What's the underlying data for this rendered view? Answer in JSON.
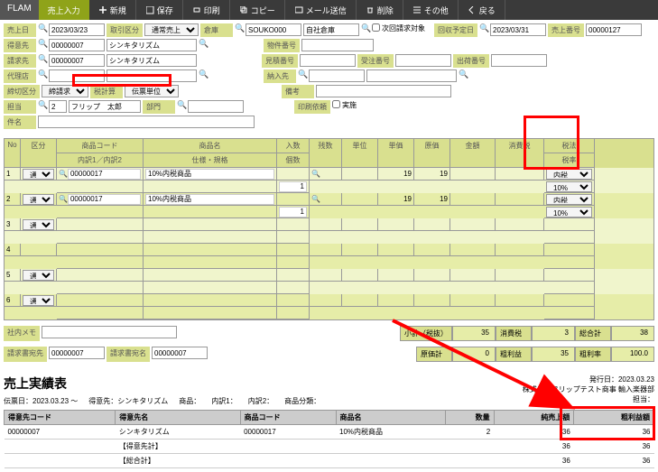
{
  "toolbar": {
    "logo": "FLAM",
    "active": "売上入力",
    "buttons": [
      "新規",
      "保存",
      "印刷",
      "コピー",
      "メール送信",
      "削除",
      "その他",
      "戻る"
    ]
  },
  "form": {
    "uriage_date_label": "売上日",
    "uriage_date": "2023/03/23",
    "torihiki_label": "取引区分",
    "torihiki": "通常売上",
    "souko_label": "倉庫",
    "souko": "SOUKO000",
    "souko_name": "自社倉庫",
    "jikai_label": "次回請求対象",
    "kaishu_label": "回収予定日",
    "kaishu_date": "2023/03/31",
    "uriage_no_label": "売上番号",
    "uriage_no": "00000127",
    "tokuisaki_label": "得意先",
    "tokuisaki_code": "00000007",
    "tokuisaki_name": "シンキタリズム",
    "bukken_label": "物件番号",
    "seikyu_label": "請求先",
    "seikyu_code": "00000007",
    "seikyu_name": "シンキタリズム",
    "mitsumori_label": "見積番号",
    "juchuno_label": "受注番号",
    "shukka_label": "出荷番号",
    "dairi_label": "代理店",
    "nounyu_label": "納入先",
    "shimekiri_label": "締切区分",
    "shimekiri_val": "締請求",
    "zeikei_label": "税計算",
    "denpyo_label": "伝票単位",
    "biko_label": "備考",
    "tantou_label": "担当",
    "tantou_code": "2",
    "tantou_name": "フリップ　太郎",
    "bumon_label": "部門",
    "insatsu_label": "印刷依頼",
    "jisshi_label": "実施",
    "kenmei_label": "件名"
  },
  "grid": {
    "headers": {
      "no": "No",
      "kbn": "区分",
      "code": "商品コード",
      "uchiwake": "内訳1／内訳2",
      "name": "商品名",
      "shiyou": "仕様・規格",
      "nyusu": "入数",
      "kosu": "個数",
      "zansu": "残数",
      "tani": "単位",
      "tanka": "単価",
      "genka": "原価",
      "kingaku": "金額",
      "shohizei": "消費税",
      "zeiho": "税法",
      "zeiritsu": "税率"
    },
    "rows": [
      {
        "no": "1",
        "kbn": "通常",
        "code": "00000017",
        "name": "10%内税商品",
        "qty": "1",
        "price": "19",
        "cost": "19",
        "tax": "内税",
        "rate": "10%"
      },
      {
        "no": "2",
        "kbn": "通常",
        "code": "00000017",
        "name": "10%内税商品",
        "qty": "1",
        "price": "19",
        "cost": "19",
        "tax": "内税",
        "rate": "10%"
      },
      {
        "no": "3",
        "kbn": "通常"
      },
      {
        "no": "4"
      },
      {
        "no": "5",
        "kbn": "通常"
      },
      {
        "no": "6",
        "kbn": "通常"
      }
    ]
  },
  "memo": {
    "shanai_label": "社内メモ",
    "seikyu_label": "請求書宛先",
    "seikyu_code": "00000007",
    "seikyu_name": "請求書宛名",
    "seikyu_name_code": "00000007"
  },
  "summary": {
    "shokei_label": "小計（税抜）",
    "shokei": "35",
    "shohizei_label": "消費税",
    "shohizei": "3",
    "goukei_label": "総合計",
    "goukei": "38",
    "genka_label": "原価計",
    "genka": "0",
    "arari_label": "粗利益",
    "arari": "35",
    "ararir_label": "粗利率",
    "ararir": "100.0"
  },
  "report": {
    "title": "売上実績表",
    "hakko_label": "発行日：",
    "hakko": "2023.03.23",
    "company": "株式会社フリップテスト商事 輸入楽器部",
    "tantou_label": "担当：",
    "denpyo_label": "伝票日：",
    "denpyo": "2023.03.23 ～",
    "tokui_label": "得意先：",
    "tokui": "シンキタリズム",
    "shohin_label": "商品：",
    "uchiwake1_label": "内訳1：",
    "uchiwake2_label": "内訳2：",
    "bunrui_label": "商品分類：",
    "cols": {
      "tokui_code": "得意先コード",
      "tokui_name": "得意先名",
      "shohin_code": "商品コード",
      "shohin_name": "商品名",
      "suryo": "数量",
      "jun_uriage": "純売上額",
      "arari": "粗利益額"
    },
    "data": [
      {
        "tokui_code": "00000007",
        "tokui_name": "シンキタリズム",
        "shohin_code": "00000017",
        "shohin_name": "10%内税商品",
        "suryo": "2",
        "jun": "36",
        "arari": "36"
      }
    ],
    "subtotal_label": "【得意先計】",
    "subtotal_jun": "36",
    "subtotal_arari": "36",
    "total_label": "【総合計】",
    "total_jun": "36",
    "total_arari": "36"
  },
  "chart_data": {
    "type": "table",
    "title": "売上実績表",
    "columns": [
      "得意先コード",
      "得意先名",
      "商品コード",
      "商品名",
      "数量",
      "純売上額",
      "粗利益額"
    ],
    "rows": [
      [
        "00000007",
        "シンキタリズム",
        "00000017",
        "10%内税商品",
        2,
        36,
        36
      ]
    ],
    "subtotals": {
      "得意先計": {
        "純売上額": 36,
        "粗利益額": 36
      }
    },
    "totals": {
      "総合計": {
        "純売上額": 36,
        "粗利益額": 36
      }
    }
  }
}
